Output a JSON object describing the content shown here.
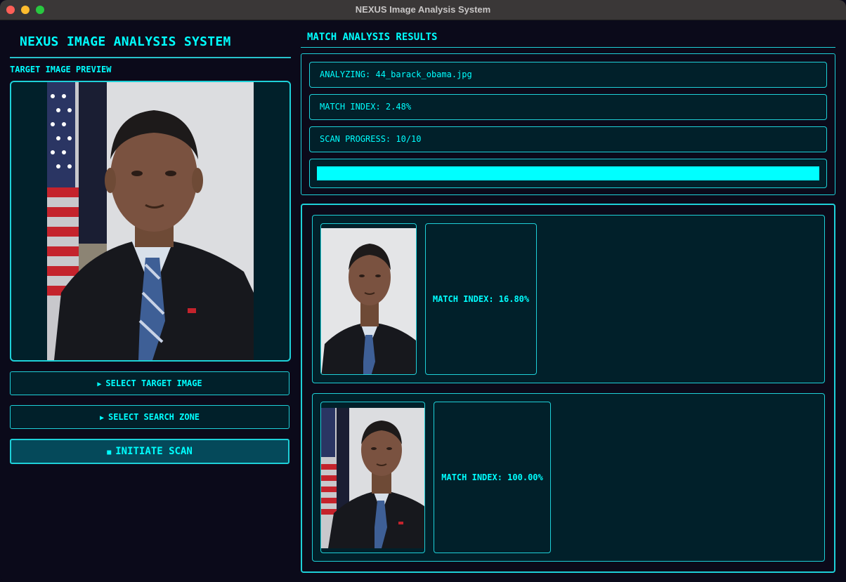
{
  "window": {
    "title": "NEXUS Image Analysis System"
  },
  "left_panel": {
    "title": "NEXUS IMAGE ANALYSIS SYSTEM",
    "preview_label": "TARGET IMAGE PREVIEW",
    "buttons": {
      "select_target": "SELECT TARGET IMAGE",
      "select_zone": "SELECT SEARCH ZONE",
      "initiate_scan": "INITIATE SCAN"
    },
    "icons": {
      "select_target": "play-triangle-icon",
      "select_zone": "play-triangle-icon",
      "initiate_scan": "stop-square-icon"
    }
  },
  "results": {
    "title": "MATCH ANALYSIS RESULTS",
    "analyzing": "ANALYZING: 44_barack_obama.jpg",
    "match_index": "MATCH INDEX: 2.48%",
    "scan_progress": "SCAN PROGRESS: 10/10",
    "progress_fraction": 1.0,
    "matches": [
      {
        "label": "MATCH INDEX: 16.80%"
      },
      {
        "label": "MATCH INDEX: 100.00%"
      }
    ]
  },
  "colors": {
    "accent": "#00ffff",
    "background": "#0b0a1a",
    "panel": "#01202a",
    "border": "#1ed0d8"
  }
}
